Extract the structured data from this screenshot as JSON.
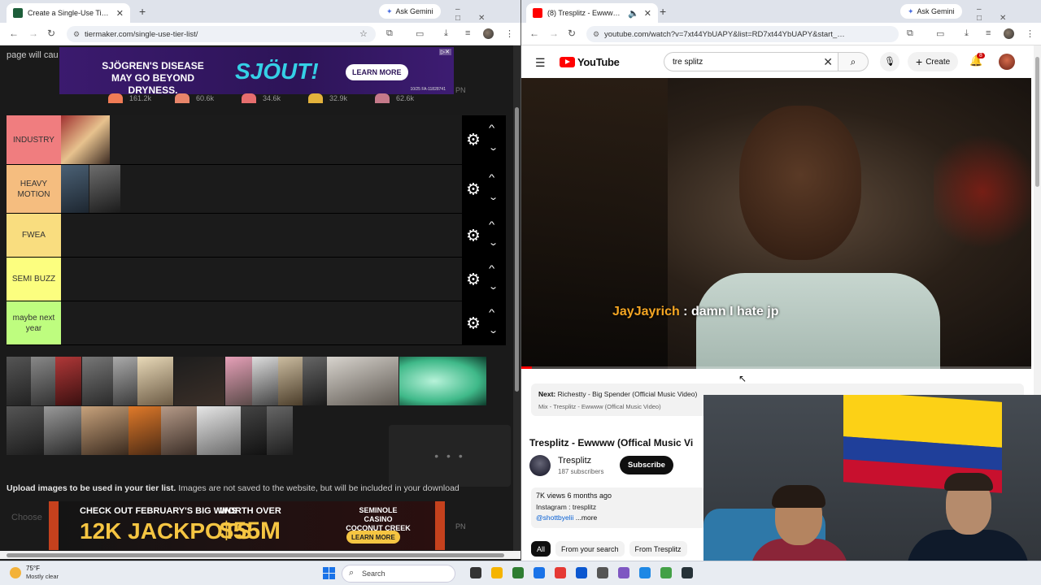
{
  "left_browser": {
    "tab_title": "Create a Single-Use Tier List (F…",
    "ask_gemini": "Ask Gemini",
    "url": "tiermaker.com/single-use-tier-list/"
  },
  "right_browser": {
    "tab_title": "(8) Tresplitz - Ewwww (Offic…",
    "ask_gemini": "Ask Gemini",
    "url": "youtube.com/watch?v=7xt44YbUAPY&list=RD7xt44YbUAPY&start_…"
  },
  "tiermaker": {
    "page_text": "page will cau",
    "top_ad": {
      "headline": "SJÖGREN'S DISEASE MAY GO BEYOND DRYNESS.",
      "brand": "SJÖUT!",
      "cta": "LEARN MORE",
      "fineprint": "10/25   FA-11828741"
    },
    "pn_label": "PN",
    "reaction_counts": [
      "161.2k",
      "60.6k",
      "34.6k",
      "32.9k",
      "62.6k"
    ],
    "tiers": [
      {
        "label": "INDUSTRY",
        "color": "#f07d7f"
      },
      {
        "label": "HEAVY MOTION",
        "color": "#f5bd7f"
      },
      {
        "label": "FWEA",
        "color": "#f9dd7f"
      },
      {
        "label": "SEMI BUZZ",
        "color": "#fcfe7f"
      },
      {
        "label": "maybe next year",
        "color": "#befd7f"
      }
    ],
    "upload_bold": "Upload images to be used in your tier list.",
    "upload_text": " Images are not saved to the website, but will be included in your download",
    "choose_label": "Choose",
    "loading_dots": "• • •",
    "bottom_ad": {
      "line1": "CHECK OUT FEBRUARY'S BIG WINS",
      "big1": "12K JACKPOTS",
      "line2": "WORTH OVER",
      "big2": "$55M",
      "brand": "SEMINOLE CASINO COCONUT CREEK",
      "cta": "LEARN MORE"
    }
  },
  "youtube": {
    "logo_text": "YouTube",
    "search_query": "tre splitz",
    "create_label": "Create",
    "notif_count": "8",
    "caption_user": "JayJayrich",
    "caption_text": " : damn I hate jp",
    "progress": 0.02,
    "next_label": "Next:",
    "next_title": "Richestty - Big Spender (Official Music Video)",
    "mix_label": "Mix - Tresplitz - Ewwww (Offical Music Video)",
    "video_title": "Tresplitz - Ewwww (Offical Music Vi",
    "channel_name": "Tresplitz",
    "subscribers": "187 subscribers",
    "subscribe_label": "Subscribe",
    "views_line": "7K views  6 months ago",
    "desc_line": "Instagram : tresplitz",
    "desc_handle": "@shottbyelii",
    "desc_more": " ...more",
    "chips": [
      "All",
      "From your search",
      "From Tresplitz"
    ]
  },
  "taskbar": {
    "temp": "75°F",
    "condition": "Mostly clear",
    "search_label": "Search"
  }
}
